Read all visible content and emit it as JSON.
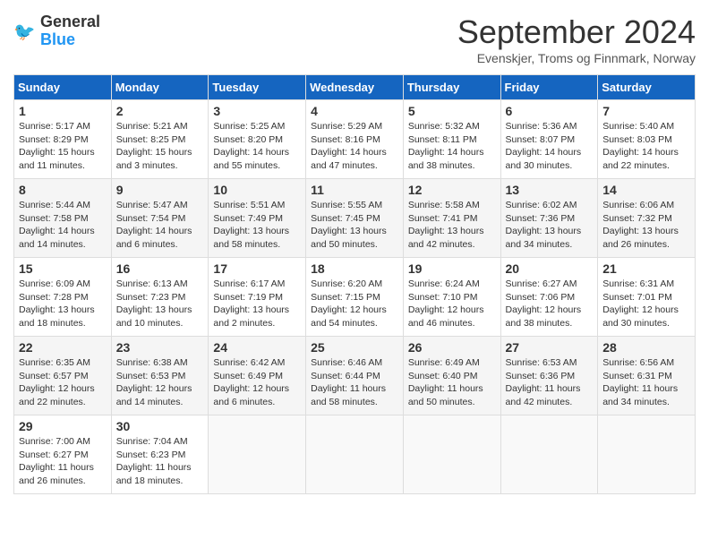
{
  "header": {
    "logo_line1": "General",
    "logo_line2": "Blue",
    "month_title": "September 2024",
    "subtitle": "Evenskjer, Troms og Finnmark, Norway"
  },
  "columns": [
    "Sunday",
    "Monday",
    "Tuesday",
    "Wednesday",
    "Thursday",
    "Friday",
    "Saturday"
  ],
  "weeks": [
    [
      {
        "day": 1,
        "sunrise": "5:17 AM",
        "sunset": "8:29 PM",
        "daylight": "15 hours and 11 minutes."
      },
      {
        "day": 2,
        "sunrise": "5:21 AM",
        "sunset": "8:25 PM",
        "daylight": "15 hours and 3 minutes."
      },
      {
        "day": 3,
        "sunrise": "5:25 AM",
        "sunset": "8:20 PM",
        "daylight": "14 hours and 55 minutes."
      },
      {
        "day": 4,
        "sunrise": "5:29 AM",
        "sunset": "8:16 PM",
        "daylight": "14 hours and 47 minutes."
      },
      {
        "day": 5,
        "sunrise": "5:32 AM",
        "sunset": "8:11 PM",
        "daylight": "14 hours and 38 minutes."
      },
      {
        "day": 6,
        "sunrise": "5:36 AM",
        "sunset": "8:07 PM",
        "daylight": "14 hours and 30 minutes."
      },
      {
        "day": 7,
        "sunrise": "5:40 AM",
        "sunset": "8:03 PM",
        "daylight": "14 hours and 22 minutes."
      }
    ],
    [
      {
        "day": 8,
        "sunrise": "5:44 AM",
        "sunset": "7:58 PM",
        "daylight": "14 hours and 14 minutes."
      },
      {
        "day": 9,
        "sunrise": "5:47 AM",
        "sunset": "7:54 PM",
        "daylight": "14 hours and 6 minutes."
      },
      {
        "day": 10,
        "sunrise": "5:51 AM",
        "sunset": "7:49 PM",
        "daylight": "13 hours and 58 minutes."
      },
      {
        "day": 11,
        "sunrise": "5:55 AM",
        "sunset": "7:45 PM",
        "daylight": "13 hours and 50 minutes."
      },
      {
        "day": 12,
        "sunrise": "5:58 AM",
        "sunset": "7:41 PM",
        "daylight": "13 hours and 42 minutes."
      },
      {
        "day": 13,
        "sunrise": "6:02 AM",
        "sunset": "7:36 PM",
        "daylight": "13 hours and 34 minutes."
      },
      {
        "day": 14,
        "sunrise": "6:06 AM",
        "sunset": "7:32 PM",
        "daylight": "13 hours and 26 minutes."
      }
    ],
    [
      {
        "day": 15,
        "sunrise": "6:09 AM",
        "sunset": "7:28 PM",
        "daylight": "13 hours and 18 minutes."
      },
      {
        "day": 16,
        "sunrise": "6:13 AM",
        "sunset": "7:23 PM",
        "daylight": "13 hours and 10 minutes."
      },
      {
        "day": 17,
        "sunrise": "6:17 AM",
        "sunset": "7:19 PM",
        "daylight": "13 hours and 2 minutes."
      },
      {
        "day": 18,
        "sunrise": "6:20 AM",
        "sunset": "7:15 PM",
        "daylight": "12 hours and 54 minutes."
      },
      {
        "day": 19,
        "sunrise": "6:24 AM",
        "sunset": "7:10 PM",
        "daylight": "12 hours and 46 minutes."
      },
      {
        "day": 20,
        "sunrise": "6:27 AM",
        "sunset": "7:06 PM",
        "daylight": "12 hours and 38 minutes."
      },
      {
        "day": 21,
        "sunrise": "6:31 AM",
        "sunset": "7:01 PM",
        "daylight": "12 hours and 30 minutes."
      }
    ],
    [
      {
        "day": 22,
        "sunrise": "6:35 AM",
        "sunset": "6:57 PM",
        "daylight": "12 hours and 22 minutes."
      },
      {
        "day": 23,
        "sunrise": "6:38 AM",
        "sunset": "6:53 PM",
        "daylight": "12 hours and 14 minutes."
      },
      {
        "day": 24,
        "sunrise": "6:42 AM",
        "sunset": "6:49 PM",
        "daylight": "12 hours and 6 minutes."
      },
      {
        "day": 25,
        "sunrise": "6:46 AM",
        "sunset": "6:44 PM",
        "daylight": "11 hours and 58 minutes."
      },
      {
        "day": 26,
        "sunrise": "6:49 AM",
        "sunset": "6:40 PM",
        "daylight": "11 hours and 50 minutes."
      },
      {
        "day": 27,
        "sunrise": "6:53 AM",
        "sunset": "6:36 PM",
        "daylight": "11 hours and 42 minutes."
      },
      {
        "day": 28,
        "sunrise": "6:56 AM",
        "sunset": "6:31 PM",
        "daylight": "11 hours and 34 minutes."
      }
    ],
    [
      {
        "day": 29,
        "sunrise": "7:00 AM",
        "sunset": "6:27 PM",
        "daylight": "11 hours and 26 minutes."
      },
      {
        "day": 30,
        "sunrise": "7:04 AM",
        "sunset": "6:23 PM",
        "daylight": "11 hours and 18 minutes."
      },
      null,
      null,
      null,
      null,
      null
    ]
  ]
}
